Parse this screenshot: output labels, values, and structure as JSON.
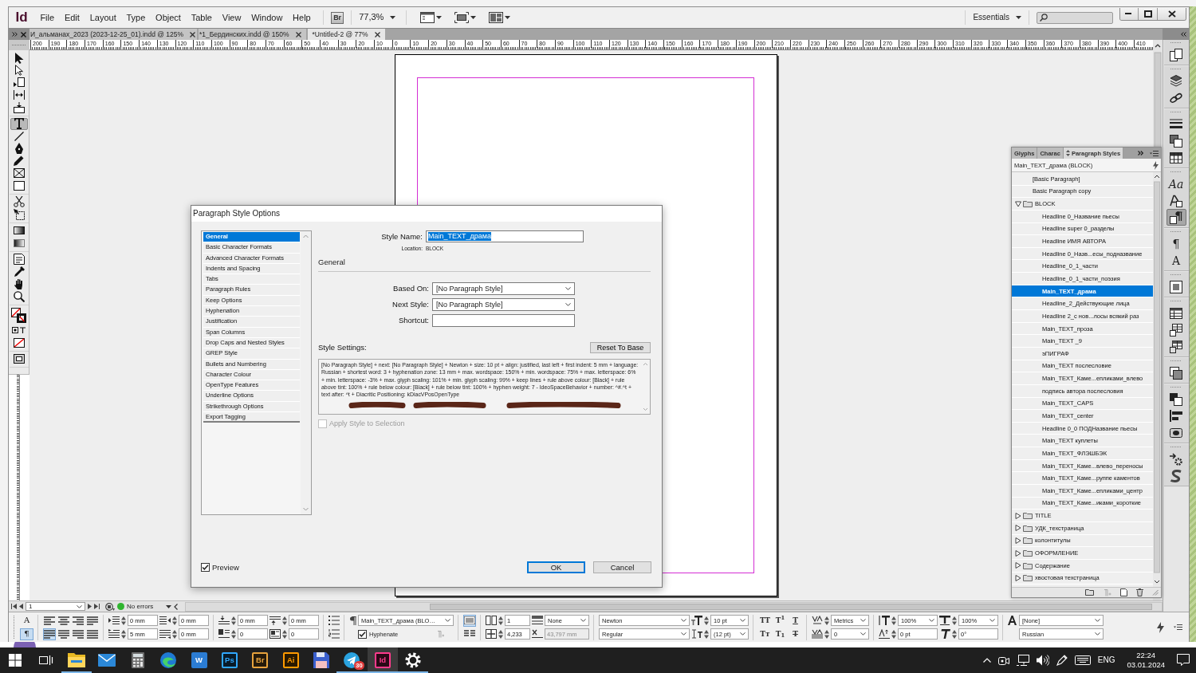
{
  "menubar": {
    "logo": "Id",
    "menus": [
      "File",
      "Edit",
      "Layout",
      "Type",
      "Object",
      "Table",
      "View",
      "Window",
      "Help"
    ],
    "bridge": "Br",
    "zoom": "77,3%",
    "workspace": "Essentials"
  },
  "doc_tabs": [
    {
      "label": "И_альманах_2023 (2023-12-25_01).indd @ 125%",
      "selected": false
    },
    {
      "label": "*1_Бердинских.indd @ 150%",
      "selected": false
    },
    {
      "label": "*Untitled-2 @ 77%",
      "selected": true
    }
  ],
  "ruler": {
    "labels": [
      "200",
      "190",
      "180",
      "170",
      "160",
      "150",
      "140",
      "130",
      "120",
      "110",
      "100",
      "90",
      "80",
      "70",
      "60",
      "50",
      "40",
      "30",
      "20",
      "10",
      "0",
      "10",
      "20",
      "30",
      "40",
      "50",
      "60",
      "70",
      "80",
      "90",
      "100",
      "110",
      "120",
      "130",
      "140",
      "150",
      "160",
      "170",
      "180",
      "190",
      "200",
      "210",
      "220",
      "230",
      "240",
      "250",
      "260",
      "270",
      "280",
      "290",
      "300",
      "310",
      "320",
      "330",
      "340",
      "350",
      "360",
      "370",
      "380",
      "390",
      "400",
      "410"
    ]
  },
  "tool_groups": [
    [
      {
        "selected": false
      },
      {
        "selected": false
      },
      {
        "selected": false
      },
      {
        "selected": false
      },
      {
        "selected": false
      }
    ],
    [
      {
        "selected": true
      },
      {
        "selected": false
      },
      {
        "selected": false
      },
      {
        "selected": false
      },
      {
        "selected": false
      },
      {
        "selected": false
      }
    ],
    [
      {
        "selected": false
      },
      {
        "selected": false
      }
    ],
    [
      {
        "selected": false
      },
      {
        "selected": false
      }
    ],
    [
      {
        "selected": false
      },
      {
        "selected": false
      },
      {
        "selected": false
      },
      {
        "selected": false
      }
    ],
    [
      {
        "selected": false
      },
      {
        "selected": false
      },
      {
        "selected": false
      }
    ],
    [
      {
        "selected": false
      }
    ]
  ],
  "dock": [
    [
      {
        "kind": "icon",
        "selected": false
      }
    ],
    [
      {
        "kind": "icon",
        "selected": false
      },
      {
        "kind": "icon",
        "selected": false
      }
    ],
    [
      {
        "kind": "icon",
        "selected": false
      },
      {
        "kind": "icon",
        "selected": false
      },
      {
        "kind": "icon",
        "selected": false
      }
    ],
    [
      {
        "kind": "glyph",
        "label": "Aa",
        "selected": false
      },
      {
        "kind": "icon",
        "selected": false
      },
      {
        "kind": "icon",
        "selected": true
      }
    ],
    [
      {
        "kind": "glyph",
        "label": "¶",
        "selected": false
      },
      {
        "kind": "glyph",
        "label": "A",
        "selected": false
      }
    ],
    [
      {
        "kind": "icon",
        "selected": false
      }
    ],
    [
      {
        "kind": "icon",
        "selected": false
      },
      {
        "kind": "icon",
        "selected": false
      },
      {
        "kind": "icon",
        "selected": false
      }
    ],
    [
      {
        "kind": "icon",
        "selected": false
      }
    ],
    [
      {
        "kind": "icon",
        "selected": false
      },
      {
        "kind": "icon",
        "selected": false
      },
      {
        "kind": "icon",
        "selected": false
      }
    ],
    [
      {
        "kind": "icon",
        "selected": false
      },
      {
        "kind": "icon",
        "selected": false
      }
    ]
  ],
  "status_bar": {
    "page": "1",
    "preflight": "No errors"
  },
  "dialog": {
    "title": "Paragraph Style Options",
    "categories": [
      {
        "label": "General",
        "selected": true
      },
      {
        "label": "Basic Character Formats",
        "selected": false
      },
      {
        "label": "Advanced Character Formats",
        "selected": false
      },
      {
        "label": "Indents and Spacing",
        "selected": false
      },
      {
        "label": "Tabs",
        "selected": false
      },
      {
        "label": "Paragraph Rules",
        "selected": false
      },
      {
        "label": "Keep Options",
        "selected": false
      },
      {
        "label": "Hyphenation",
        "selected": false
      },
      {
        "label": "Justification",
        "selected": false
      },
      {
        "label": "Span Columns",
        "selected": false
      },
      {
        "label": "Drop Caps and Nested Styles",
        "selected": false
      },
      {
        "label": "GREP Style",
        "selected": false
      },
      {
        "label": "Bullets and Numbering",
        "selected": false
      },
      {
        "label": "Character Colour",
        "selected": false
      },
      {
        "label": "OpenType Features",
        "selected": false
      },
      {
        "label": "Underline Options",
        "selected": false
      },
      {
        "label": "Strikethrough Options",
        "selected": false
      },
      {
        "label": "Export Tagging",
        "selected": false
      }
    ],
    "style_name": {
      "label": "Style Name:",
      "value": "Main_TEXT_драма",
      "selected": true
    },
    "location": {
      "label": "Location:",
      "value": "BLOCK"
    },
    "section": "General",
    "based_on": {
      "label": "Based On:",
      "value": "[No Paragraph Style]"
    },
    "next_style": {
      "label": "Next Style:",
      "value": "[No Paragraph Style]"
    },
    "shortcut": {
      "label": "Shortcut:"
    },
    "settings_label": "Style Settings:",
    "reset_button": "Reset To Base",
    "settings_text": "[No Paragraph Style] + next: [No Paragraph Style] + Newton + size: 10 pt + align: justified, last left + first indent: 5 mm + language: Russian + shortest word: 3 + hyphenation zone:  13 mm + max. wordspace: 150% + min. wordspace: 75% + max. letterspace: 6% + min. letterspace: -3% + max. glyph scaling:  101% + min. glyph scaling:   99% + keep lines + rule above colour: [Black] + rule above tint: 100% + rule below colour: [Black] + rule below tint: 100% + hyphen weight: 7 - IdeoSpaceBehavior +  number: ^#.^t +  text after: ^t + Diacritic Positioning: kDiacVPosOpenType",
    "apply": {
      "label": "Apply Style to Selection",
      "checked": false,
      "disabled": true
    },
    "preview": {
      "label": "Preview",
      "checked": true
    },
    "buttons": [
      {
        "label": "OK",
        "kind": "default"
      },
      {
        "label": "Cancel",
        "kind": "normal"
      }
    ]
  },
  "styles_panel": {
    "tabs": [
      {
        "label": "Glyphs",
        "selected": false
      },
      {
        "label": "Charac",
        "selected": false
      },
      {
        "label": "Paragraph Styles",
        "selected": true
      }
    ],
    "current": "Main_TEXT_драма (BLOCK)",
    "styles": [
      {
        "label": "[Basic Paragraph]",
        "kind": "style",
        "selected": false
      },
      {
        "label": "Basic Paragraph copy",
        "kind": "style",
        "selected": false
      },
      {
        "label": "BLOCK",
        "kind": "folder",
        "expanded": true,
        "selected": false,
        "children": [
          {
            "label": "Headline 0_Название пьесы",
            "kind": "style",
            "selected": false
          },
          {
            "label": "Headline super 0_разделы",
            "kind": "style",
            "selected": false
          },
          {
            "label": "Headline ИМЯ АВТОРА",
            "kind": "style",
            "selected": false
          },
          {
            "label": "Headline 0_Назв...есы_подназвание",
            "kind": "style",
            "selected": false
          },
          {
            "label": "Headline_0_1_части",
            "kind": "style",
            "selected": false
          },
          {
            "label": "Headline_0_1_части_поэзия",
            "kind": "style",
            "selected": false
          },
          {
            "label": "Main_TEXT_драма",
            "kind": "style",
            "selected": true
          },
          {
            "label": "Headline_2_Действующие лица",
            "kind": "style",
            "selected": false
          },
          {
            "label": "Headline 2_с нов...лосы всякий раз",
            "kind": "style",
            "selected": false
          },
          {
            "label": "Main_TEXT_проза",
            "kind": "style",
            "selected": false
          },
          {
            "label": "Main_TEXT _9",
            "kind": "style",
            "selected": false
          },
          {
            "label": "эПИГРАФ",
            "kind": "style",
            "selected": false
          },
          {
            "label": "Main_TEXT послесловие",
            "kind": "style",
            "selected": false
          },
          {
            "label": "Main_TEXT_Каме...епликами_влево",
            "kind": "style",
            "selected": false
          },
          {
            "label": "подпись автора послесловия",
            "kind": "style",
            "selected": false
          },
          {
            "label": "Main_TEXT_CAPS",
            "kind": "style",
            "selected": false
          },
          {
            "label": "Main_TEXT_center",
            "kind": "style",
            "selected": false
          },
          {
            "label": "Headline 0_0 ПОДНазвание пьесы",
            "kind": "style",
            "selected": false
          },
          {
            "label": "Main_TEXT куплеты",
            "kind": "style",
            "selected": false
          },
          {
            "label": "Main_TEXT_ФЛЭШБЭК",
            "kind": "style",
            "selected": false
          },
          {
            "label": "Main_TEXT_Каме...влево_переносы",
            "kind": "style",
            "selected": false
          },
          {
            "label": "Main_TEXT_Каме...руппе каментов",
            "kind": "style",
            "selected": false
          },
          {
            "label": "Main_TEXT_Каме...епликами_центр",
            "kind": "style",
            "selected": false
          },
          {
            "label": "Main_TEXT_Каме...иками_короткие",
            "kind": "style",
            "selected": false
          }
        ]
      },
      {
        "label": "TITLE",
        "kind": "folder",
        "expanded": false,
        "selected": false
      },
      {
        "label": "УДК_техстраница",
        "kind": "folder",
        "expanded": false,
        "selected": false
      },
      {
        "label": "колонтитулы",
        "kind": "folder",
        "expanded": false,
        "selected": false
      },
      {
        "label": "ОФОРМЛЕНИЕ",
        "kind": "folder",
        "expanded": false,
        "selected": false
      },
      {
        "label": "Содержание",
        "kind": "folder",
        "expanded": false,
        "selected": false
      },
      {
        "label": "хвостовая техстраница",
        "kind": "folder",
        "expanded": false,
        "selected": false
      }
    ]
  },
  "control_panel": {
    "mode_buttons": [
      {
        "label": "A",
        "selected": false
      },
      {
        "label": "¶",
        "selected": true
      }
    ],
    "align_buttons": [
      {
        "selected": false
      },
      {
        "selected": false
      },
      {
        "selected": false
      },
      {
        "selected": false
      },
      {
        "selected": true
      },
      {
        "selected": false
      },
      {
        "selected": false
      },
      {
        "selected": false
      }
    ],
    "left_indent": "0 mm",
    "right_indent": "0 mm",
    "first_line_indent": "5 mm",
    "last_line_indent": "0 mm",
    "space_before": "0 mm",
    "space_after": "0 mm",
    "drop_cap_lines": "0",
    "drop_cap_characters": "0",
    "paragraph_style": "Main_TEXT_драма (BLO…",
    "hyphenate": {
      "label": "Hyphenate",
      "checked": true
    },
    "grid_align_buttons": [
      {
        "selected": true
      },
      {
        "selected": false
      }
    ],
    "columns": "1",
    "span_value": "4,233",
    "shading": "None",
    "x_position": {
      "value": "43,797 mm",
      "disabled": true
    },
    "font_family": "Newton",
    "font_style": "Regular",
    "font_size": "10 pt",
    "leading": "(12 pt)",
    "case_buttons": [
      {
        "label": "TT",
        "kind": "plain"
      },
      {
        "label": "T$^{1}$",
        "kind": "plain"
      },
      {
        "label": "T",
        "kind": "underline"
      },
      {
        "label": "Tᴛ",
        "kind": "plain"
      },
      {
        "label": "T$_{1}$",
        "kind": "plain"
      },
      {
        "label": "T",
        "kind": "strike"
      }
    ],
    "kerning": "Metrics",
    "tracking": "0",
    "vertical_scale": "100%",
    "baseline_shift": "0 pt",
    "horizontal_scale": "100%",
    "skew": "0°",
    "character_style": "[None]",
    "language": "Russian"
  },
  "taskbar": {
    "apps": [
      {
        "kind": "start",
        "selected": false,
        "running": false
      },
      {
        "kind": "task-view",
        "selected": false,
        "running": false
      },
      {
        "kind": "folder",
        "selected": false,
        "running": true
      },
      {
        "kind": "mail",
        "selected": false,
        "running": false
      },
      {
        "kind": "calculator",
        "selected": false,
        "running": false
      },
      {
        "kind": "browser",
        "selected": false,
        "running": false
      },
      {
        "kind": "doc-tile",
        "label": "W",
        "color": "#2b7cd3",
        "selected": false,
        "running": false
      },
      {
        "kind": "tile",
        "label": "Ps",
        "color": "#31a8ff",
        "selected": false,
        "running": false
      },
      {
        "kind": "tile",
        "label": "Br",
        "color": "#e8a33d",
        "selected": false,
        "running": false
      },
      {
        "kind": "tile",
        "label": "Ai",
        "color": "#ff9a00",
        "selected": false,
        "running": false
      },
      {
        "kind": "floppy",
        "selected": false,
        "running": false
      },
      {
        "kind": "messenger",
        "badge": "30",
        "selected": false,
        "running": true
      },
      {
        "kind": "tile",
        "label": "Id",
        "color": "#ff3a8c",
        "selected": true,
        "running": true
      },
      {
        "kind": "gear",
        "selected": false,
        "running": true
      }
    ],
    "tray": {
      "language": "ENG",
      "time": "22:24",
      "date": "03.01.2024"
    }
  }
}
